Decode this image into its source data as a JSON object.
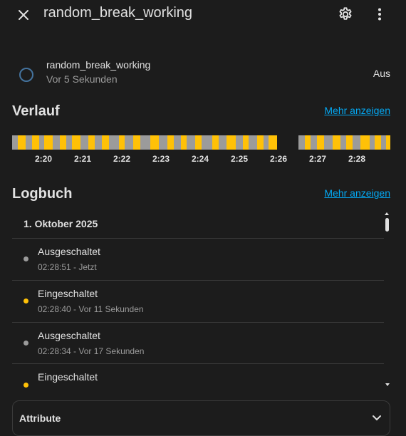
{
  "header": {
    "title": "random_break_working",
    "close_icon": "close-icon",
    "settings_icon": "gear-icon",
    "menu_icon": "more-vertical-icon"
  },
  "entity": {
    "name": "random_break_working",
    "last_changed": "Vor 5 Sekunden",
    "state": "Aus",
    "icon": "circle-outline-icon"
  },
  "history": {
    "title": "Verlauf",
    "more_link": "Mehr anzeigen",
    "ticks": [
      "2:20",
      "2:21",
      "2:22",
      "2:23",
      "2:24",
      "2:25",
      "2:26",
      "2:27",
      "2:28"
    ],
    "colors": {
      "on": "#ffc107",
      "off": "#9b9b9b"
    }
  },
  "logbook": {
    "title": "Logbuch",
    "more_link": "Mehr anzeigen",
    "date": "1. Oktober 2025",
    "entries": [
      {
        "title": "Ausgeschaltet",
        "time": "02:28:51 - Jetzt",
        "state": "off"
      },
      {
        "title": "Eingeschaltet",
        "time": "02:28:40 - Vor 11 Sekunden",
        "state": "on"
      },
      {
        "title": "Ausgeschaltet",
        "time": "02:28:34 - Vor 17 Sekunden",
        "state": "off"
      },
      {
        "title": "Eingeschaltet",
        "time": "",
        "state": "on"
      }
    ]
  },
  "attributes": {
    "label": "Attribute"
  }
}
